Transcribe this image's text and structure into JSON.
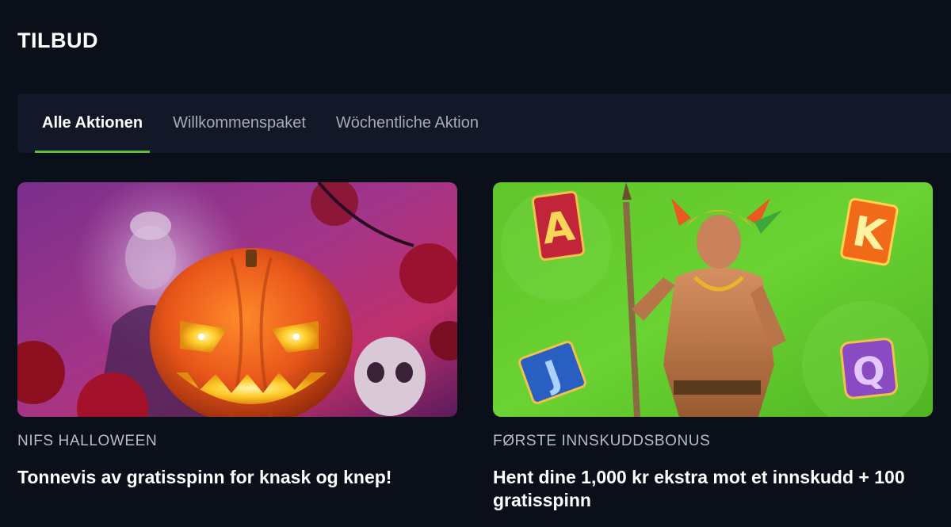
{
  "page": {
    "title": "TILBUD"
  },
  "tabs": [
    {
      "label": "Alle Aktionen",
      "active": true
    },
    {
      "label": "Willkommenspaket",
      "active": false
    },
    {
      "label": "Wöchentliche Aktion",
      "active": false
    }
  ],
  "colors": {
    "background": "#0b0f19",
    "tabbar": "#121827",
    "accent": "#5fbf32",
    "muted_text": "#a6abb6"
  },
  "promotions": [
    {
      "category": "NIFS HALLOWEEN",
      "headline": "Tonnevis av gratisspinn for knask og knep!",
      "image_icon": "jack-o-lantern-illustration"
    },
    {
      "category": "FØRSTE INNSKUDDSBONUS",
      "headline": "Hent dine 1,000 kr ekstra mot et innskudd + 100 gratisspinn",
      "image_icon": "aztec-warrior-illustration",
      "letters": [
        "A",
        "K",
        "J",
        "Q"
      ]
    }
  ]
}
